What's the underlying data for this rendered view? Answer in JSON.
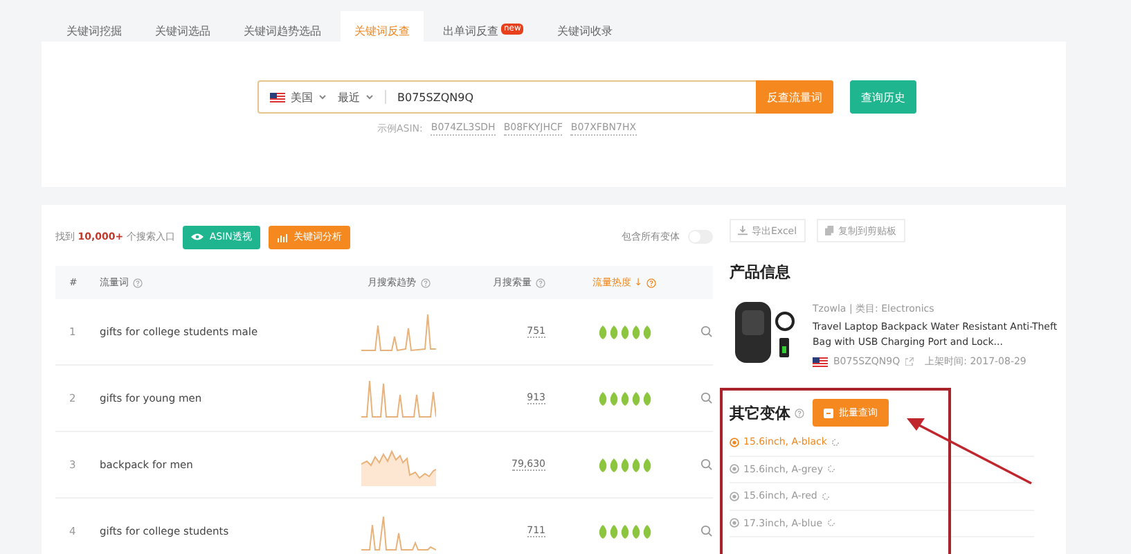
{
  "tabs": [
    {
      "label": "关键词挖掘",
      "selected": false
    },
    {
      "label": "关键词选品",
      "selected": false
    },
    {
      "label": "关键词趋势选品",
      "selected": false
    },
    {
      "label": "关键词反查",
      "selected": true
    },
    {
      "label": "出单词反查",
      "selected": false,
      "badge": "new"
    },
    {
      "label": "关键词收录",
      "selected": false
    }
  ],
  "search": {
    "country": "美国",
    "period": "最近",
    "value": "B075SZQN9Q",
    "submit": "反查流量词",
    "history": "查询历史",
    "example_label": "示例ASIN:",
    "examples": [
      "B074ZL3SDH",
      "B08FKYJHCF",
      "B07XFBN7HX"
    ]
  },
  "results": {
    "prefix": "找到",
    "count": "10,000+",
    "suffix": "个搜索入口",
    "asin_button": "ASIN透视",
    "keyword_button": "关键词分析",
    "variants_toggle": {
      "label": "包含所有变体",
      "on": false
    }
  },
  "table": {
    "columns": [
      "#",
      "流量词",
      "月搜索趋势",
      "月搜索量",
      "流量热度"
    ],
    "sort_mark": "↓",
    "rows": [
      {
        "index": "1",
        "keyword": "gifts for college students male",
        "volume": "751",
        "stars": 5
      },
      {
        "index": "2",
        "keyword": "gifts for young men",
        "volume": "913",
        "stars": 5
      },
      {
        "index": "3",
        "keyword": "backpack for men",
        "volume": "79,630",
        "stars": 5
      },
      {
        "index": "4",
        "keyword": "gifts for college students",
        "volume": "711",
        "stars": 5
      }
    ]
  },
  "actions": [
    "导出Excel",
    "复制到剪贴板"
  ],
  "product": {
    "heading": "产品信息",
    "brand": "Tzowla",
    "separator": "|",
    "category": "类目: Electronics",
    "title": "Travel Laptop Backpack Water Resistant Anti-Theft Bag with USB Charging Port and Lock...",
    "asin": "B075SZQN9Q",
    "listed": "上架时间: 2017-08-29"
  },
  "variants": {
    "heading": "其它变体",
    "batch_button": "批量查询",
    "items": [
      {
        "label": "15.6inch, A-black",
        "selected": true
      },
      {
        "label": "15.6inch, A-grey",
        "selected": false
      },
      {
        "label": "15.6inch, A-red",
        "selected": false
      },
      {
        "label": "17.3inch, A-blue",
        "selected": false
      }
    ]
  }
}
